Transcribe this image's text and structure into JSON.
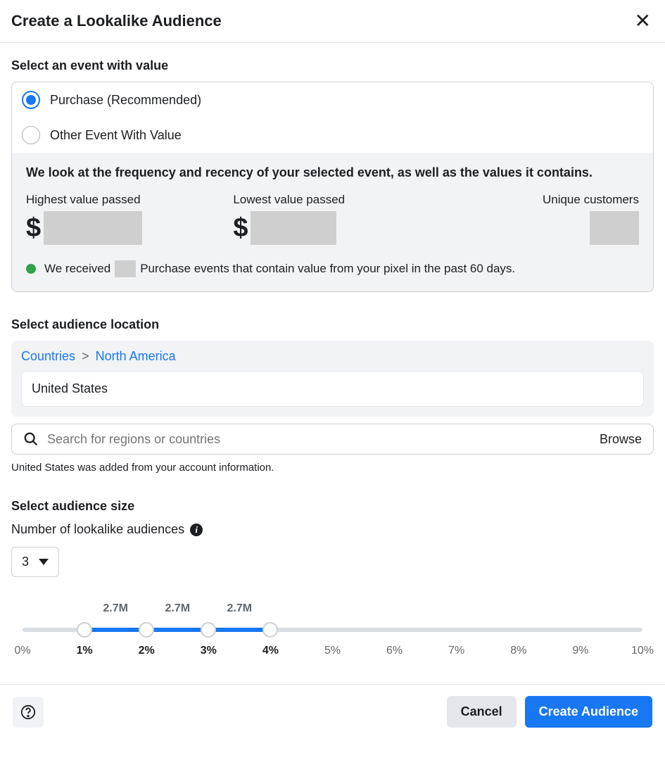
{
  "header": {
    "title": "Create a Lookalike Audience"
  },
  "section_event": {
    "title": "Select an event with value",
    "options": {
      "purchase": "Purchase (Recommended)",
      "other": "Other Event With Value"
    },
    "selected": "purchase",
    "info": {
      "heading": "We look at the frequency and recency of your selected event, as well as the values it contains.",
      "stats": {
        "highest_label": "Highest value passed",
        "lowest_label": "Lowest value passed",
        "unique_label": "Unique customers"
      },
      "events_line_pre": "We received",
      "events_line_post": "Purchase events that contain value from your pixel in the past 60 days."
    }
  },
  "section_location": {
    "title": "Select audience location",
    "breadcrumb": {
      "countries": "Countries",
      "region": "North America"
    },
    "chip": "United States",
    "search_placeholder": "Search for regions or countries",
    "browse": "Browse",
    "helper": "United States was added from your account information."
  },
  "section_size": {
    "title": "Select audience size",
    "counter_label": "Number of lookalike audiences",
    "counter_value": "3",
    "slider": {
      "range_ticks": [
        "0%",
        "1%",
        "2%",
        "3%",
        "4%",
        "5%",
        "6%",
        "7%",
        "8%",
        "9%",
        "10%"
      ],
      "handles_percent": [
        10,
        20,
        30,
        40
      ],
      "fill_start_percent": 10,
      "fill_end_percent": 40,
      "size_labels": [
        {
          "at_percent": 15,
          "text": "2.7M"
        },
        {
          "at_percent": 25,
          "text": "2.7M"
        },
        {
          "at_percent": 35,
          "text": "2.7M"
        }
      ],
      "bold_ticks": [
        1,
        2,
        3,
        4
      ]
    }
  },
  "footer": {
    "cancel": "Cancel",
    "create": "Create Audience"
  }
}
